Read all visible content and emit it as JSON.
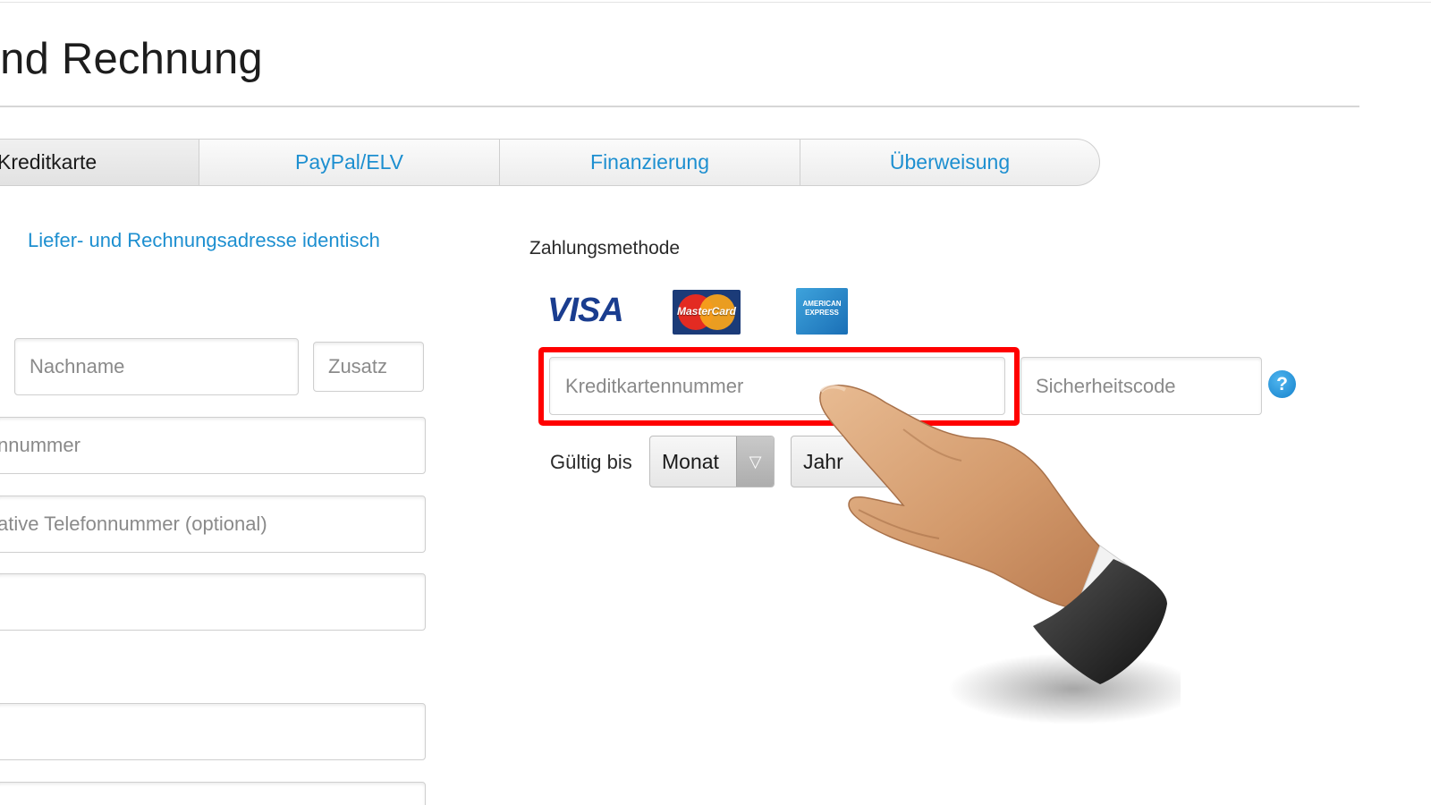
{
  "page": {
    "title": "ng und Rechnung"
  },
  "tabs": [
    {
      "label": "Kreditkarte"
    },
    {
      "label": "PayPal/ELV"
    },
    {
      "label": "Finanzierung"
    },
    {
      "label": "Überweisung"
    }
  ],
  "address": {
    "identical_link": "Liefer- und Rechnungsadresse identisch"
  },
  "form": {
    "lastname_placeholder": "Nachname",
    "suffix_placeholder": "Zusatz",
    "phone_placeholder": "nnummer",
    "alt_phone_placeholder": "ative Telefonnummer (optional)"
  },
  "payment": {
    "method_label": "Zahlungsmethode",
    "logos": {
      "visa": "VISA",
      "mastercard": "MasterCard",
      "amex": "AMERICAN EXPRESS"
    },
    "card_number_placeholder": "Kreditkartennummer",
    "security_code_placeholder": "Sicherheitscode",
    "help": "?",
    "valid_label": "Gültig bis",
    "month_value": "Monat",
    "year_value": "Jahr"
  },
  "colors": {
    "link": "#1d8fd0",
    "highlight": "#ff0000",
    "help": "#1582cc"
  }
}
